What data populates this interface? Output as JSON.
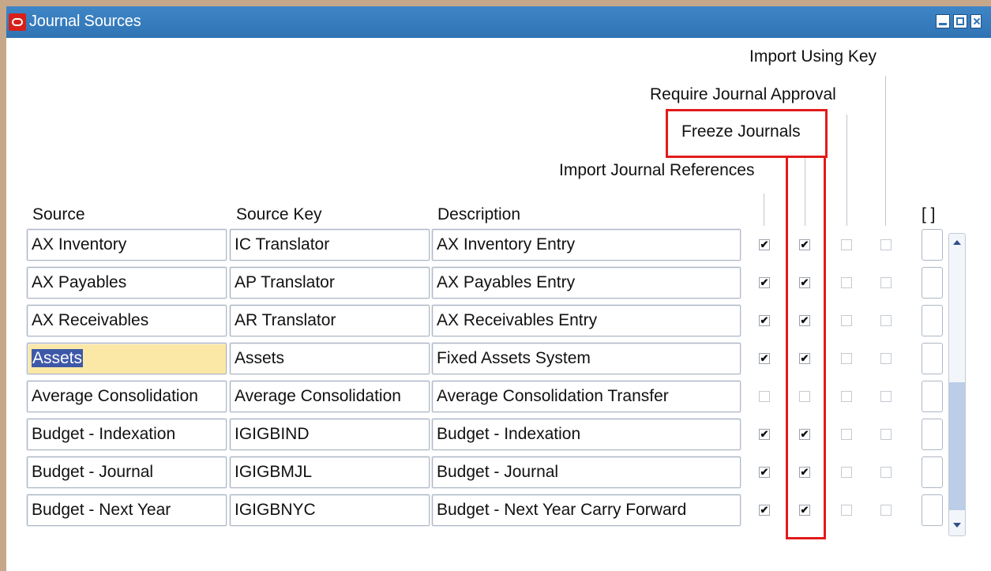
{
  "window": {
    "title": "Journal Sources"
  },
  "headers": {
    "source": "Source",
    "source_key": "Source Key",
    "description": "Description",
    "import_using_key": "Import Using Key",
    "require_journal_approval": "Require Journal Approval",
    "freeze_journals": "Freeze Journals",
    "import_journal_references": "Import Journal References",
    "record_indicator": "[ ]"
  },
  "rows": [
    {
      "source": "AX Inventory",
      "source_key": "IC Translator",
      "description": "AX Inventory Entry",
      "import_refs": true,
      "freeze": true,
      "approval": false,
      "key": false
    },
    {
      "source": "AX Payables",
      "source_key": "AP Translator",
      "description": "AX Payables Entry",
      "import_refs": true,
      "freeze": true,
      "approval": false,
      "key": false
    },
    {
      "source": "AX Receivables",
      "source_key": "AR Translator",
      "description": "AX Receivables Entry",
      "import_refs": true,
      "freeze": true,
      "approval": false,
      "key": false
    },
    {
      "source": "Assets",
      "source_key": "Assets",
      "description": "Fixed Assets System",
      "import_refs": true,
      "freeze": true,
      "approval": false,
      "key": false
    },
    {
      "source": "Average Consolidation",
      "source_key": "Average Consolidation",
      "description": "Average Consolidation Transfer",
      "import_refs": false,
      "freeze": false,
      "approval": false,
      "key": false
    },
    {
      "source": "Budget - Indexation",
      "source_key": "IGIGBIND",
      "description": "Budget - Indexation",
      "import_refs": true,
      "freeze": true,
      "approval": false,
      "key": false
    },
    {
      "source": "Budget - Journal",
      "source_key": "IGIGBMJL",
      "description": "Budget - Journal",
      "import_refs": true,
      "freeze": true,
      "approval": false,
      "key": false
    },
    {
      "source": "Budget - Next Year",
      "source_key": "IGIGBNYC",
      "description": "Budget - Next Year Carry Forward",
      "import_refs": true,
      "freeze": true,
      "approval": false,
      "key": false
    }
  ],
  "selected_row": 3,
  "colors": {
    "titlebar": "#2f73b4",
    "highlight": "#e21b1b",
    "selected_field": "#fbe8a6",
    "text_selection": "#3e58a8"
  },
  "icons": {
    "app": "oracle-logo-icon",
    "check": "checkmark-icon"
  }
}
